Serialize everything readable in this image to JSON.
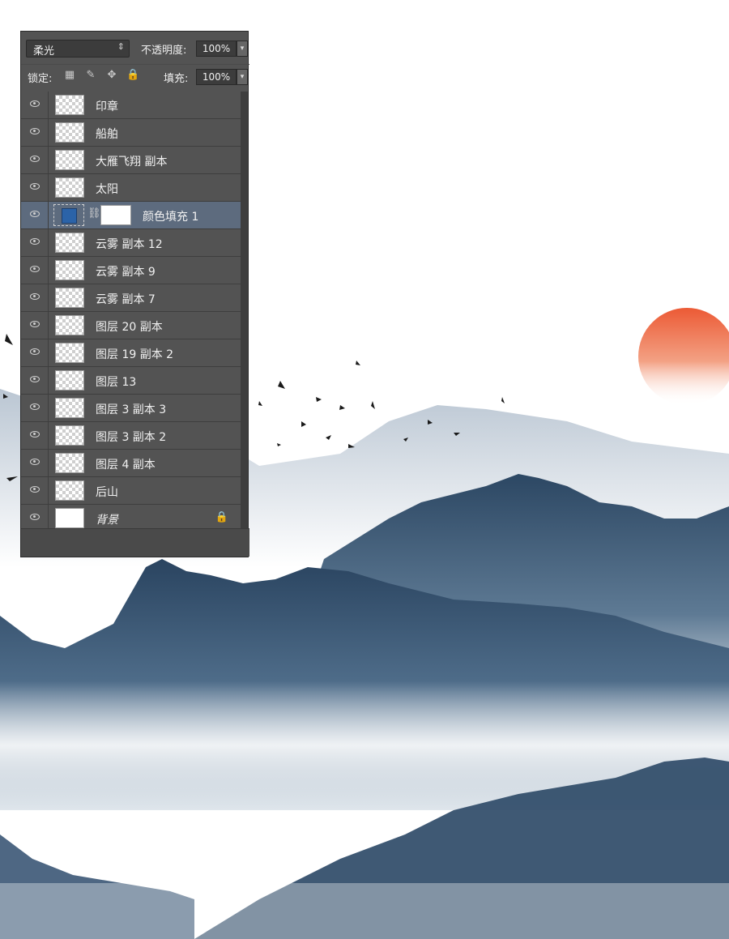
{
  "layers_panel": {
    "blend_mode": "柔光",
    "opacity_label": "不透明度:",
    "opacity_value": "100%",
    "lock_label": "锁定:",
    "fill_label": "填充:",
    "fill_value": "100%",
    "layers": [
      {
        "name": "印章",
        "thumb": "transparent"
      },
      {
        "name": "船舶",
        "thumb": "transparent"
      },
      {
        "name": "大雁飞翔 副本",
        "thumb": "transparent"
      },
      {
        "name": "太阳",
        "thumb": "transparent"
      },
      {
        "name": "颜色填充 1",
        "thumb": "fill",
        "selected": true
      },
      {
        "name": "云雾 副本 12",
        "thumb": "transparent"
      },
      {
        "name": "云雾 副本 9",
        "thumb": "transparent"
      },
      {
        "name": "云雾 副本 7",
        "thumb": "transparent"
      },
      {
        "name": "图层 20 副本",
        "thumb": "transparent"
      },
      {
        "name": "图层 19 副本 2",
        "thumb": "transparent"
      },
      {
        "name": "图层 13",
        "thumb": "transparent"
      },
      {
        "name": "图层 3 副本 3",
        "thumb": "transparent"
      },
      {
        "name": "图层 3 副本 2",
        "thumb": "transparent"
      },
      {
        "name": "图层 4 副本",
        "thumb": "transparent"
      },
      {
        "name": "后山",
        "thumb": "transparent"
      },
      {
        "name": "背景",
        "thumb": "white",
        "locked": true
      }
    ]
  },
  "colors": {
    "fill_color": "#2b63a8",
    "sun": "#e8603f",
    "mountain_dark": "#2f4a66",
    "mist": "#e9eef3"
  }
}
